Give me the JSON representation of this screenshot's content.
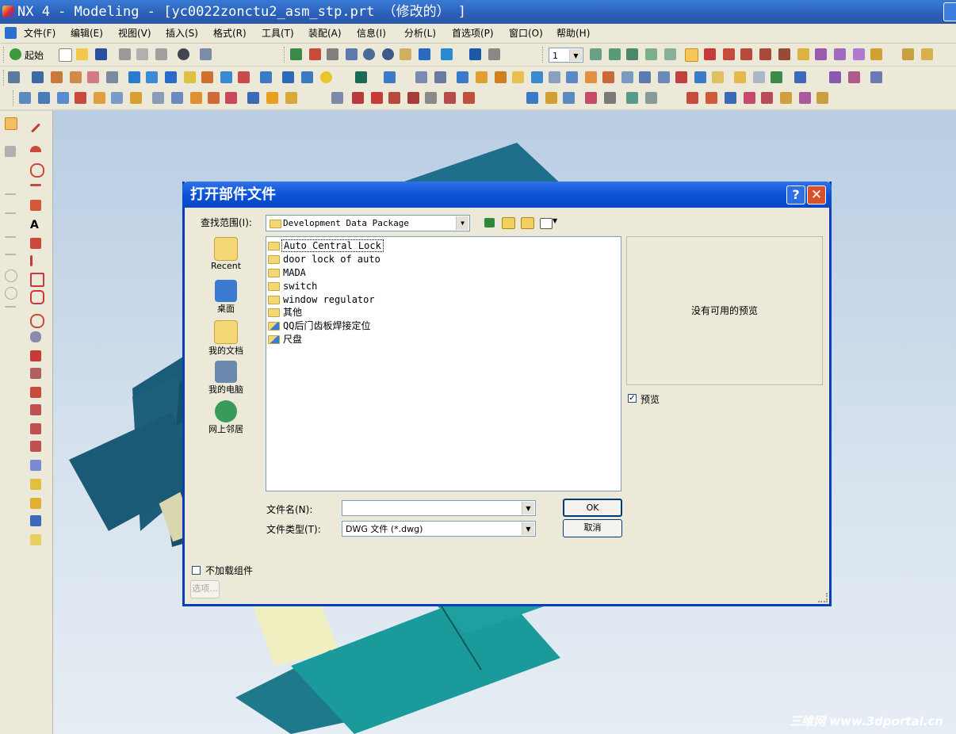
{
  "window": {
    "title": "NX 4 - Modeling - [yc0022zonctu2_asm_stp.prt （修改的） ]"
  },
  "menu": [
    "文件(F)",
    "编辑(E)",
    "视图(V)",
    "插入(S)",
    "格式(R)",
    "工具(T)",
    "装配(A)",
    "信息(I)",
    "分析(L)",
    "首选项(P)",
    "窗口(O)",
    "帮助(H)"
  ],
  "toolbar": {
    "start_label": "起始",
    "layer_value": "1"
  },
  "dialog": {
    "title": "打开部件文件",
    "look_in_label": "查找范围(I):",
    "look_in_value": "Development Data Package",
    "places": [
      "Recent",
      "桌面",
      "我的文档",
      "我的电脑",
      "网上邻居"
    ],
    "files": [
      {
        "name": "Auto Central Lock",
        "type": "folder",
        "selected": true
      },
      {
        "name": "door lock of auto",
        "type": "folder",
        "selected": false
      },
      {
        "name": "MADA",
        "type": "folder",
        "selected": false
      },
      {
        "name": "switch",
        "type": "folder",
        "selected": false
      },
      {
        "name": "window regulator",
        "type": "folder",
        "selected": false
      },
      {
        "name": "其他",
        "type": "folder",
        "selected": false
      },
      {
        "name": "QQ后门齿板焊接定位",
        "type": "shortcut",
        "selected": false
      },
      {
        "name": "尺盘",
        "type": "shortcut",
        "selected": false
      }
    ],
    "preview_text": "没有可用的预览",
    "preview_checkbox_label": "预览",
    "filename_label": "文件名(N):",
    "filename_value": "",
    "filetype_label": "文件类型(T):",
    "filetype_value": "DWG 文件 (*.dwg)",
    "ok_label": "OK",
    "cancel_label": "取消",
    "no_load_label": "不加载组件",
    "options_label": "选项..."
  },
  "watermark": "三维网 www.3dportal.cn"
}
